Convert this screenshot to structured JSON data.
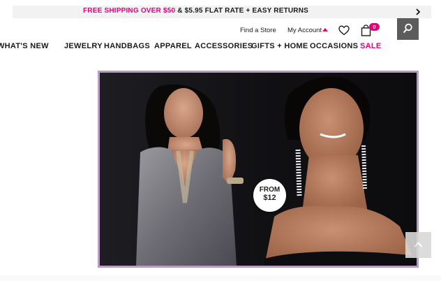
{
  "promo": {
    "highlight": "FREE SHIPPING OVER $50",
    "rest": " & $5.95 FLAT RATE + EASY RETURNS",
    "arrow_icon": "chevron-right-icon"
  },
  "utility": {
    "find_store": "Find a Store",
    "my_account": "My Account",
    "bag_count": "0"
  },
  "nav": {
    "items": [
      "WHAT'S NEW",
      "JEWELRY",
      "HANDBAGS",
      "APPAREL",
      "ACCESSORIES",
      "GIFTS + HOME",
      "OCCASIONS",
      "SALE"
    ]
  },
  "hero": {
    "badge_line1": "FROM",
    "badge_line2": "$12"
  },
  "colors": {
    "accent": "#e6007e",
    "hero_border": "#b99bc4",
    "search_bg": "#5c5c5c"
  }
}
